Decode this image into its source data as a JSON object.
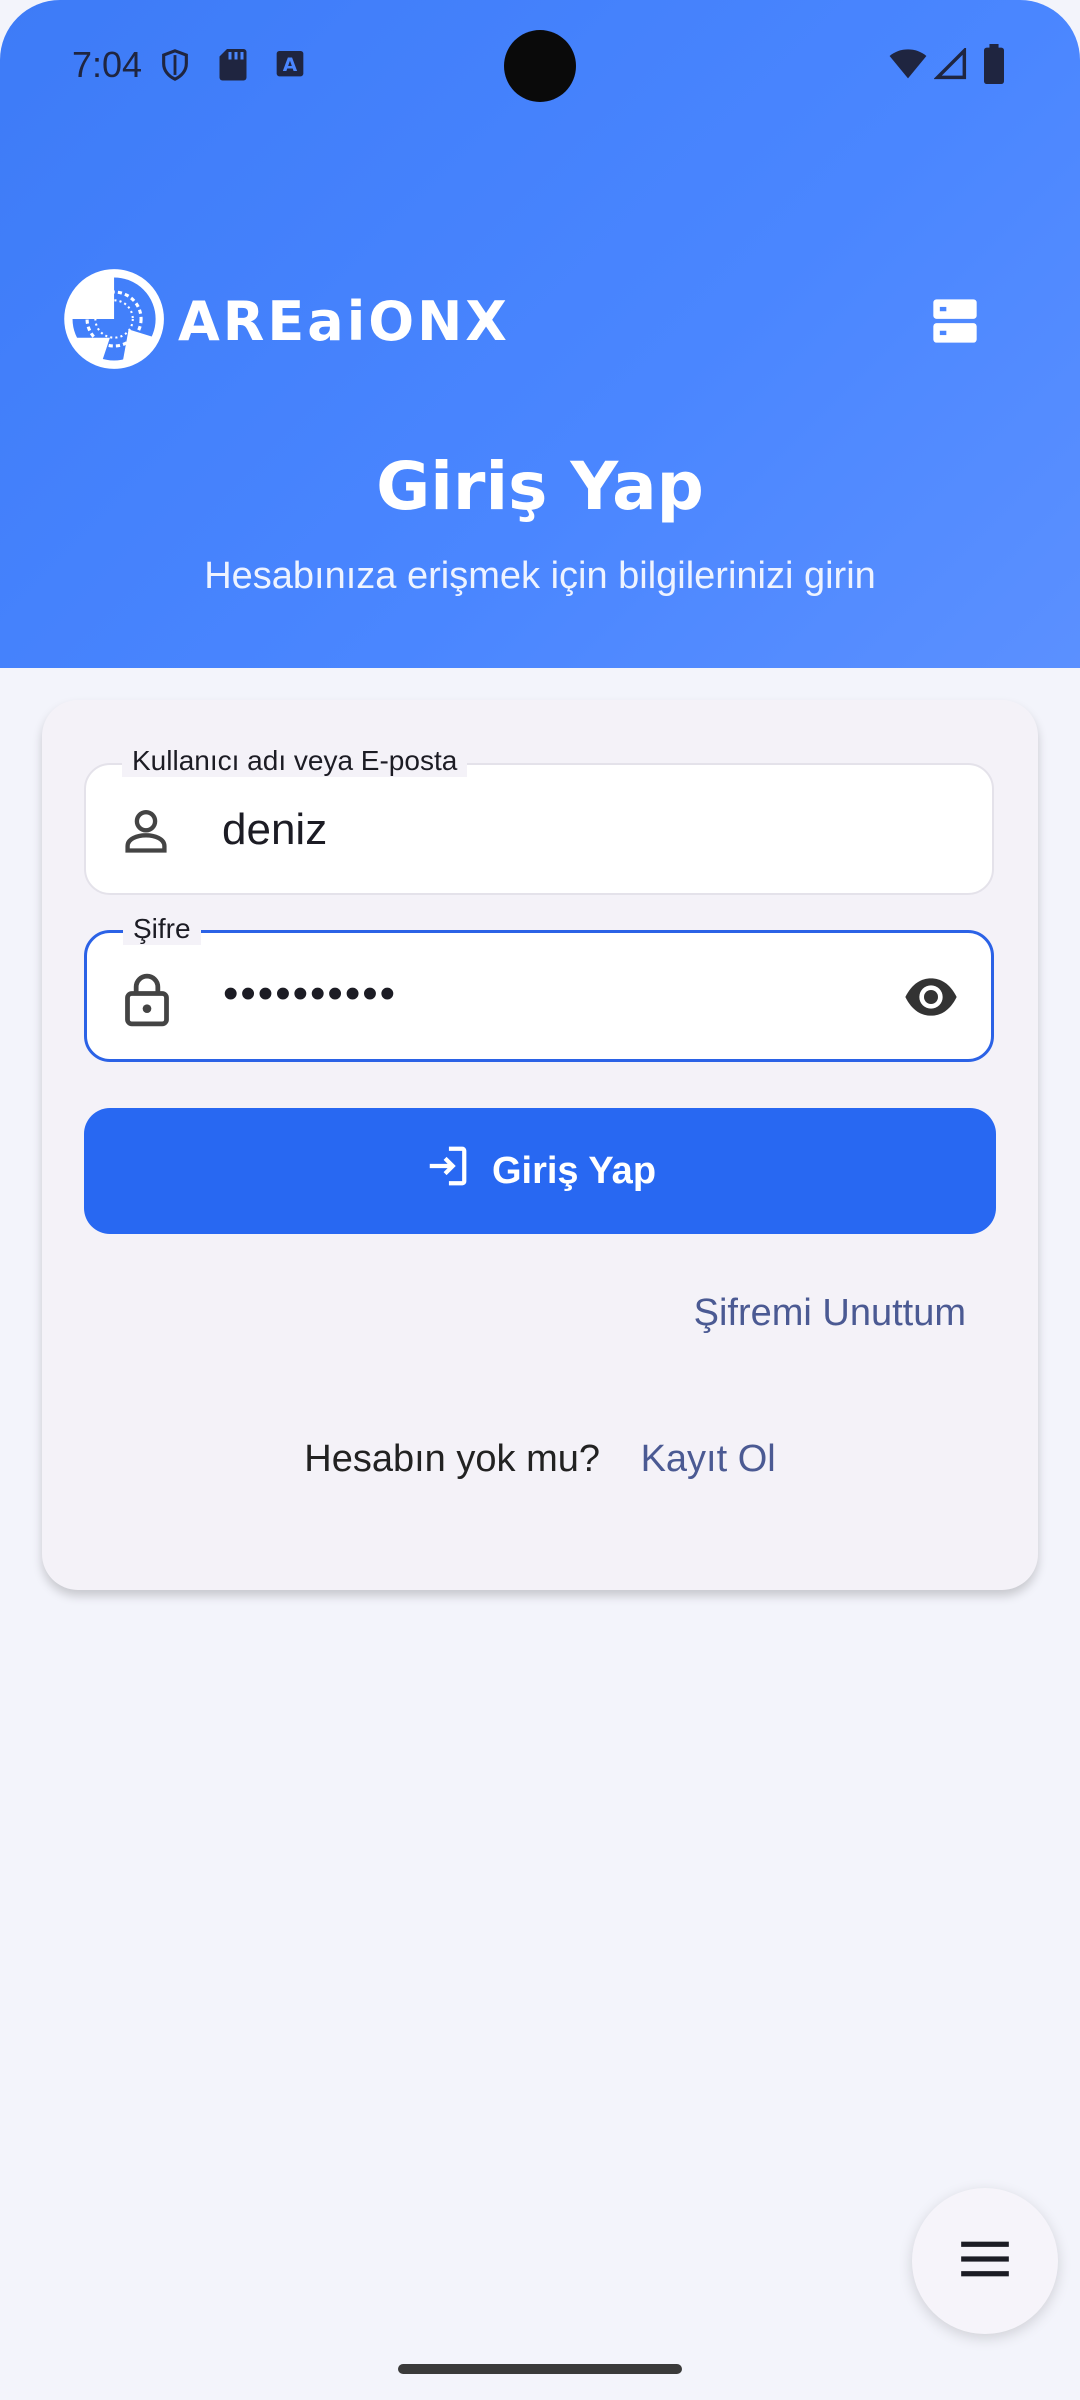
{
  "status_bar": {
    "time": "7:04"
  },
  "header": {
    "brand_name": "AREaiONX",
    "title": "Giriş Yap",
    "subtitle": "Hesabınıza erişmek için bilgilerinizi girin"
  },
  "form": {
    "username_label": "Kullanıcı adı veya E-posta",
    "username_value": "deniz",
    "password_label": "Şifre",
    "password_value": "••••••••••",
    "login_button": "Giriş Yap",
    "forgot_link": "Şifremi Unuttum",
    "signup_question": "Hesabın yok mu?",
    "signup_link": "Kayıt Ol"
  },
  "colors": {
    "hero": "#3d7bf7",
    "primary_button": "#2868f2",
    "link": "#4b5a93",
    "focused_border": "#2b62e6"
  }
}
